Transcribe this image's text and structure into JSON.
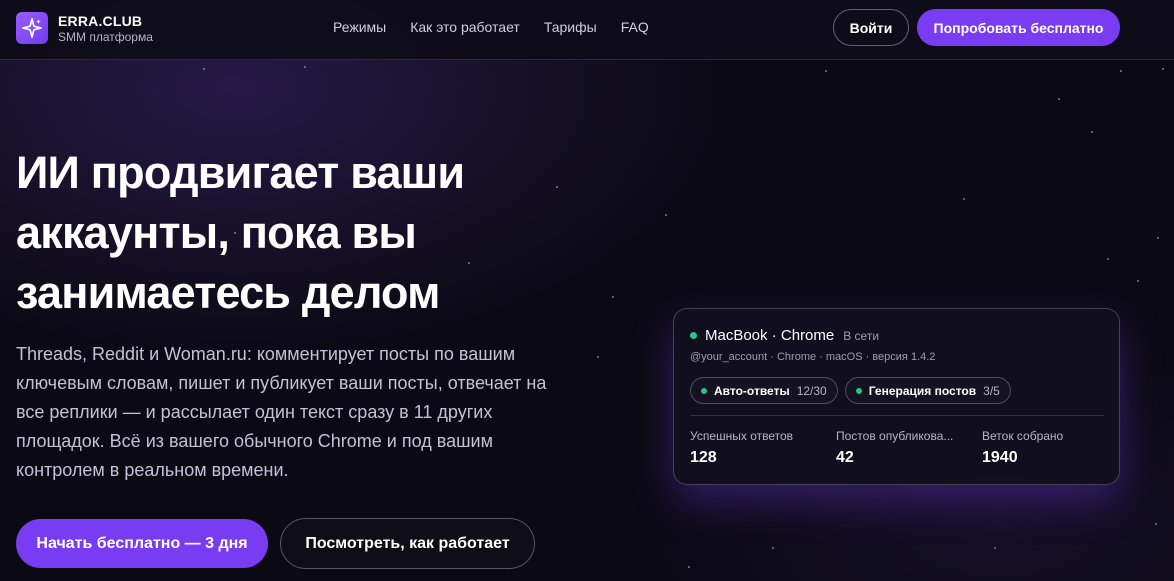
{
  "colors": {
    "accent": "#7a3cf2",
    "background": "#0b0a14",
    "online": "#27c48a"
  },
  "header": {
    "logo_title": "ERRA.CLUB",
    "logo_subtitle": "SMM платформа",
    "logo_icon": "sparkle-icon",
    "nav": [
      {
        "label": "Режимы"
      },
      {
        "label": "Как это работает"
      },
      {
        "label": "Тарифы"
      },
      {
        "label": "FAQ"
      }
    ],
    "login_label": "Войти",
    "try_label": "Попробовать бесплатно"
  },
  "hero": {
    "title_lines": [
      "ИИ продвигает ваши",
      "аккаунты, пока вы",
      "занимаетесь делом"
    ],
    "description_lines": [
      "Threads, Reddit и Woman.ru: комментирует посты по вашим",
      "ключевым словам, пишет и публикует ваши посты, отвечает на",
      "все реплики — и рассылает один текст сразу в 11 других",
      "площадок. Всё из вашего обычного Chrome и под вашим",
      "контролем в реальном времени."
    ],
    "start_label": "Начать бесплатно — 3 дня",
    "how_label": "Посмотреть, как работает"
  },
  "card": {
    "device": "MacBook · Chrome",
    "status": "В сети",
    "meta": "@your_account · Chrome · macOS · версия 1.4.2",
    "chips": [
      {
        "label": "Авто-ответы",
        "count": "12/30"
      },
      {
        "label": "Генерация постов",
        "count": "3/5"
      }
    ],
    "stats": [
      {
        "label": "Успешных ответов",
        "value": "128"
      },
      {
        "label": "Постов опубликова...",
        "value": "42"
      },
      {
        "label": "Веток собрано",
        "value": "1940"
      }
    ]
  }
}
